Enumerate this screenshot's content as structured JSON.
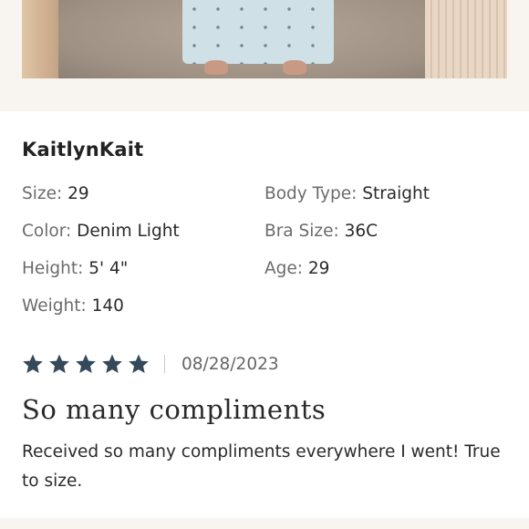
{
  "review": {
    "username": "KaitlynKait",
    "attributes": {
      "size": {
        "label": "Size:",
        "value": "29"
      },
      "color": {
        "label": "Color:",
        "value": "Denim Light"
      },
      "height": {
        "label": "Height:",
        "value": "5' 4\""
      },
      "weight": {
        "label": "Weight:",
        "value": "140"
      },
      "body_type": {
        "label": "Body Type:",
        "value": "Straight"
      },
      "bra_size": {
        "label": "Bra Size:",
        "value": "36C"
      },
      "age": {
        "label": "Age:",
        "value": "29"
      }
    },
    "rating": 5,
    "rating_max": 5,
    "date": "08/28/2023",
    "title": "So many compliments",
    "body": "Received so many compliments everywhere I went! True to size."
  },
  "colors": {
    "star": "#34495a",
    "page_background": "#f8f4f0",
    "card_background": "#ffffff"
  },
  "icons": {
    "rating_star": "star-icon"
  }
}
